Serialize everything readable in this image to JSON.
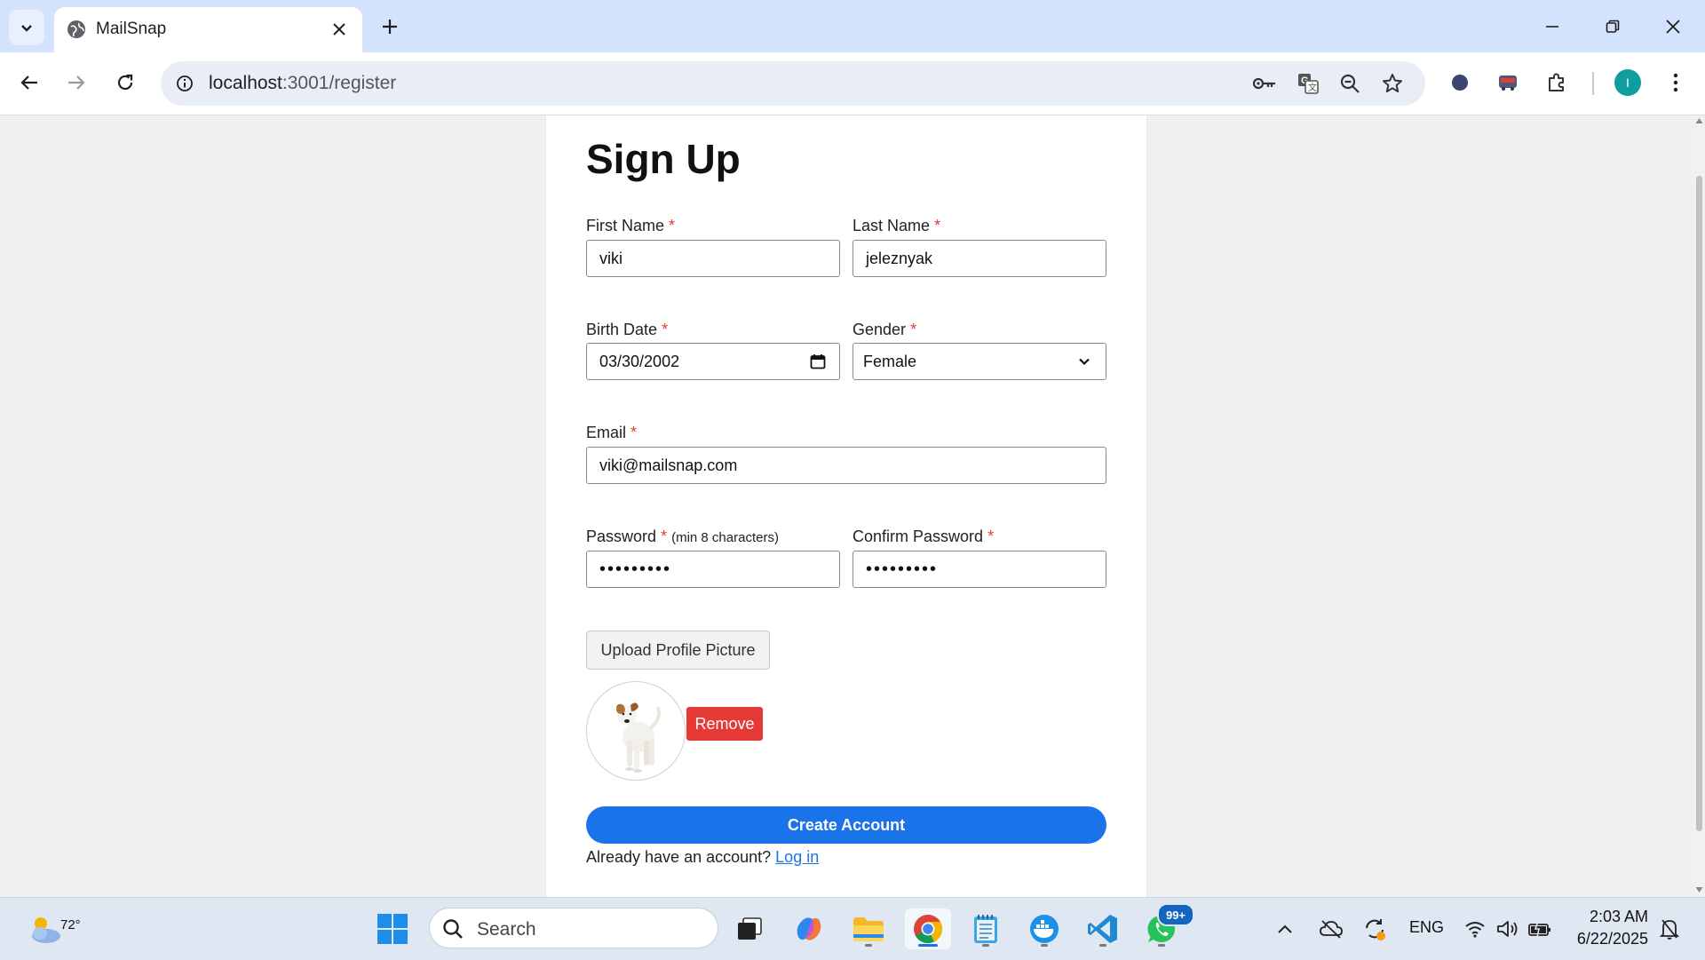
{
  "browser": {
    "tab_title": "MailSnap",
    "url_host": "localhost",
    "url_path": ":3001/register"
  },
  "form": {
    "title": "Sign Up",
    "required_mark": "*",
    "first_name_label": "First Name",
    "first_name_value": "viki",
    "last_name_label": "Last Name",
    "last_name_value": "jeleznyak",
    "birth_date_label": "Birth Date",
    "birth_date_value": "03/30/2002",
    "gender_label": "Gender",
    "gender_value": "Female",
    "email_label": "Email",
    "email_value": "viki@mailsnap.com",
    "password_label": "Password",
    "password_hint": "(min 8 characters)",
    "password_value": "•••••••••",
    "confirm_password_label": "Confirm Password",
    "confirm_password_value": "•••••••••",
    "upload_button": "Upload Profile Picture",
    "remove_button": "Remove",
    "create_button": "Create Account",
    "login_prompt": "Already have an account?",
    "login_link": "Log in"
  },
  "taskbar": {
    "weather_temp": "72°",
    "search_placeholder": "Search",
    "whatsapp_badge": "99+",
    "language": "ENG",
    "time": "2:03 AM",
    "date": "6/22/2025"
  },
  "colors": {
    "accent": "#1a73e8",
    "danger": "#e53935",
    "tabstrip": "#d3e3fd",
    "avatar": "#0f9d9d"
  },
  "icons": [
    "tab-search-icon",
    "globe-icon",
    "close-icon",
    "plus-icon",
    "minimize-icon",
    "restore-icon",
    "back-icon",
    "forward-icon",
    "reload-icon",
    "site-info-icon",
    "key-icon",
    "translate-icon",
    "zoom-icon",
    "star-icon",
    "extension-dot-icon",
    "extension-train-icon",
    "puzzle-icon",
    "kebab-menu-icon",
    "calendar-icon",
    "chevron-down-icon",
    "windows-start-icon",
    "search-icon",
    "weather-icon",
    "cloud-icon",
    "sync-icon",
    "wifi-icon",
    "volume-icon",
    "battery-icon"
  ]
}
